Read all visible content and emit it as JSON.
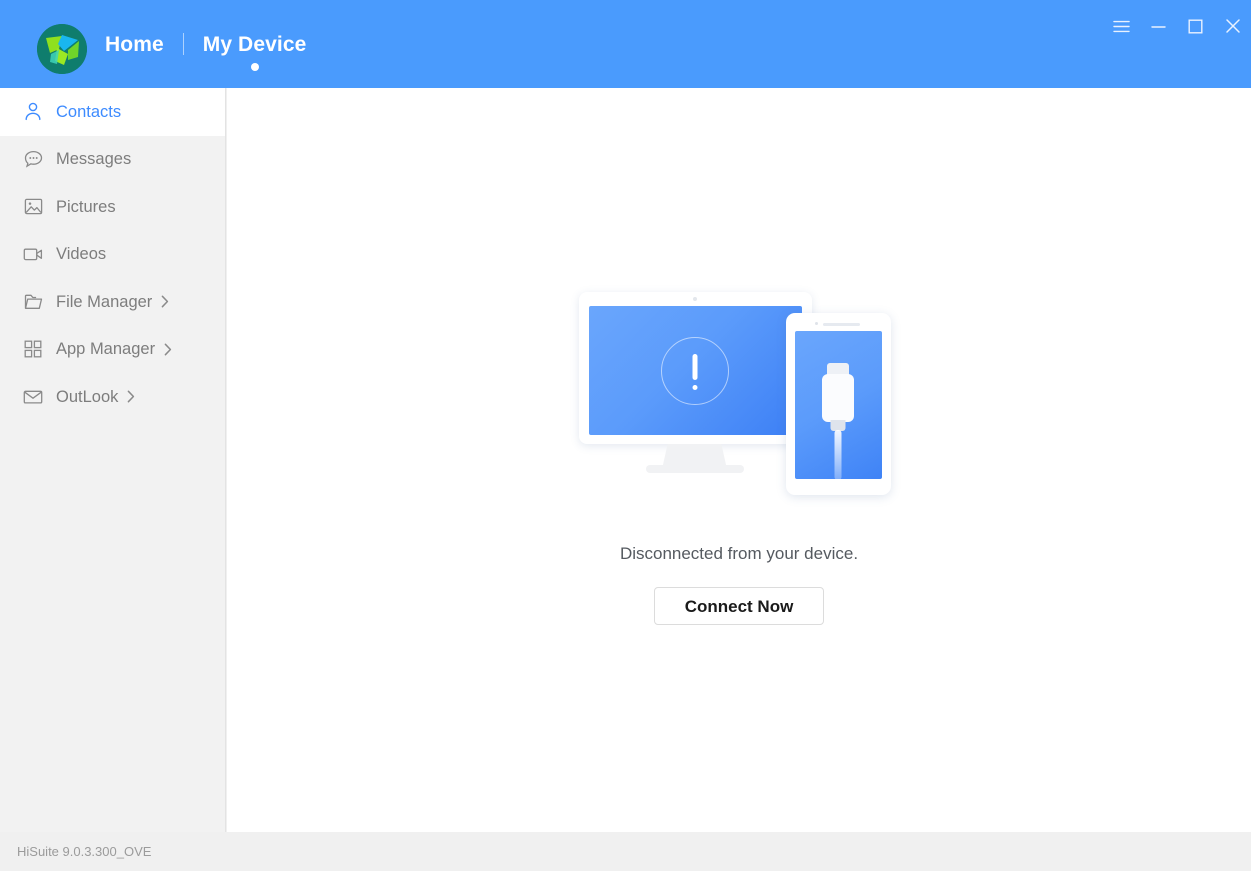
{
  "app": {
    "title": "HiSuite",
    "version_text": "HiSuite 9.0.3.300_OVE",
    "accent_color": "#4a9bfd",
    "sidebar_bg": "#f2f2f2",
    "active_item_color": "#3d8bff"
  },
  "header": {
    "logo_name": "hisuite-logo",
    "nav": [
      {
        "label": "Home",
        "active": false
      },
      {
        "label": "My Device",
        "active": true
      }
    ],
    "window_controls": [
      {
        "name": "menu-icon",
        "label": "Menu"
      },
      {
        "name": "minimize-icon",
        "label": "Minimize"
      },
      {
        "name": "maximize-icon",
        "label": "Maximize"
      },
      {
        "name": "close-icon",
        "label": "Close"
      }
    ]
  },
  "sidebar": {
    "items": [
      {
        "label": "Contacts",
        "icon": "person-icon",
        "active": true,
        "chevron": false
      },
      {
        "label": "Messages",
        "icon": "chat-icon",
        "active": false,
        "chevron": false
      },
      {
        "label": "Pictures",
        "icon": "image-icon",
        "active": false,
        "chevron": false
      },
      {
        "label": "Videos",
        "icon": "video-icon",
        "active": false,
        "chevron": false
      },
      {
        "label": "File Manager",
        "icon": "folder-icon",
        "active": false,
        "chevron": true
      },
      {
        "label": "App Manager",
        "icon": "grid-icon",
        "active": false,
        "chevron": true
      },
      {
        "label": "OutLook",
        "icon": "envelope-icon",
        "active": false,
        "chevron": true
      }
    ]
  },
  "main": {
    "illustration_name": "disconnected-devices-illustration",
    "status_message": "Disconnected from your device.",
    "connect_button_label": "Connect Now"
  }
}
